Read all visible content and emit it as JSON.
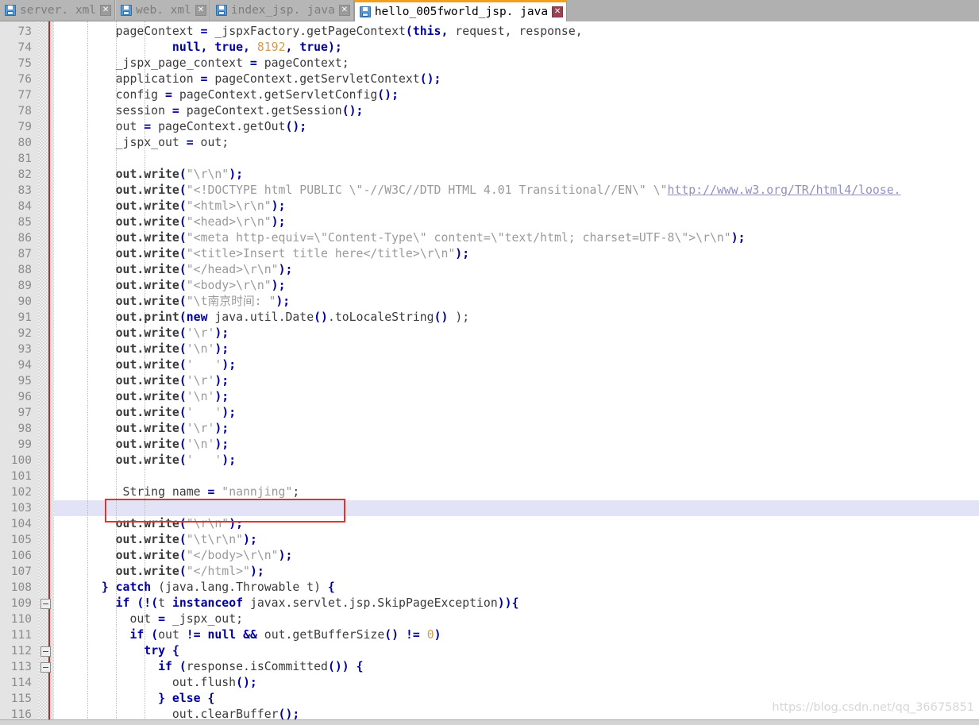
{
  "window": {
    "app": "Eclipse IDE Java Editor",
    "watermark": "https://blog.csdn.net/qq_36675851"
  },
  "tabs": [
    {
      "label": "server. xml",
      "icon": "save-floppy-icon",
      "active": false,
      "close": "✕"
    },
    {
      "label": "web. xml",
      "icon": "save-floppy-icon",
      "active": false,
      "close": "✕"
    },
    {
      "label": "index_jsp. java",
      "icon": "save-floppy-icon",
      "active": false,
      "close": "✕"
    },
    {
      "label": "hello_005fworld_jsp. java",
      "icon": "save-floppy-icon",
      "active": true,
      "close": "✕"
    }
  ],
  "editor": {
    "first_line": 73,
    "last_line": 116,
    "current_line": 103,
    "annotation": {
      "type": "red-rectangle",
      "target_line": 102,
      "target_text": "String name = \"nannjing\";"
    },
    "fold_marker_lines": [
      109,
      112,
      113
    ],
    "colors": {
      "keyword": "#00009e",
      "number": "#d69b4a",
      "string": "#9a9a9a",
      "plain": "#3b3b3b",
      "link": "#9090c0",
      "current_line_bg": "#e3e3f7",
      "gutter_bg": "#e4e4e4",
      "annotation_red": "#ea3223",
      "active_tab_accent": "#f4a017"
    },
    "lines": [
      {
        "n": 73,
        "tokens": [
          [
            "plain",
            "    pageContext "
          ],
          [
            "op",
            "= "
          ],
          [
            "plain",
            "_jspxFactory.getPageContext"
          ],
          [
            "op",
            "("
          ],
          [
            "kw",
            "this"
          ],
          [
            "op",
            ","
          ],
          [
            "plain",
            " request, response,"
          ]
        ]
      },
      {
        "n": 74,
        "tokens": [
          [
            "plain",
            "            "
          ],
          [
            "kw",
            "null"
          ],
          [
            "op",
            ", "
          ],
          [
            "kw",
            "true"
          ],
          [
            "op",
            ", "
          ],
          [
            "num",
            "8192"
          ],
          [
            "op",
            ", "
          ],
          [
            "kw",
            "true"
          ],
          [
            "op",
            ");"
          ]
        ]
      },
      {
        "n": 75,
        "tokens": [
          [
            "plain",
            "    _jspx_page_context "
          ],
          [
            "op",
            "= "
          ],
          [
            "plain",
            "pageContext;"
          ]
        ]
      },
      {
        "n": 76,
        "tokens": [
          [
            "plain",
            "    application "
          ],
          [
            "op",
            "= "
          ],
          [
            "plain",
            "pageContext.getServletContext"
          ],
          [
            "op",
            "();"
          ]
        ]
      },
      {
        "n": 77,
        "tokens": [
          [
            "plain",
            "    config "
          ],
          [
            "op",
            "= "
          ],
          [
            "plain",
            "pageContext.getServletConfig"
          ],
          [
            "op",
            "();"
          ]
        ]
      },
      {
        "n": 78,
        "tokens": [
          [
            "plain",
            "    session "
          ],
          [
            "op",
            "= "
          ],
          [
            "plain",
            "pageContext.getSession"
          ],
          [
            "op",
            "();"
          ]
        ]
      },
      {
        "n": 79,
        "tokens": [
          [
            "plain",
            "    out "
          ],
          [
            "op",
            "= "
          ],
          [
            "plain",
            "pageContext.getOut"
          ],
          [
            "op",
            "();"
          ]
        ]
      },
      {
        "n": 80,
        "tokens": [
          [
            "plain",
            "    _jspx_out "
          ],
          [
            "op",
            "= "
          ],
          [
            "plain",
            "out;"
          ]
        ]
      },
      {
        "n": 81,
        "tokens": []
      },
      {
        "n": 82,
        "tokens": [
          [
            "plain",
            "    "
          ],
          [
            "id",
            "out.write"
          ],
          [
            "op",
            "("
          ],
          [
            "str",
            "\"\\r\\n\""
          ],
          [
            "op",
            ");"
          ]
        ]
      },
      {
        "n": 83,
        "tokens": [
          [
            "plain",
            "    "
          ],
          [
            "id",
            "out.write"
          ],
          [
            "op",
            "("
          ],
          [
            "str",
            "\"<!DOCTYPE html PUBLIC \\\"-//W3C//DTD HTML 4.01 Transitional//EN\\\" \\\""
          ],
          [
            "link",
            "http://www.w3.org/TR/html4/loose."
          ]
        ]
      },
      {
        "n": 84,
        "tokens": [
          [
            "plain",
            "    "
          ],
          [
            "id",
            "out.write"
          ],
          [
            "op",
            "("
          ],
          [
            "str",
            "\"<html>\\r\\n\""
          ],
          [
            "op",
            ");"
          ]
        ]
      },
      {
        "n": 85,
        "tokens": [
          [
            "plain",
            "    "
          ],
          [
            "id",
            "out.write"
          ],
          [
            "op",
            "("
          ],
          [
            "str",
            "\"<head>\\r\\n\""
          ],
          [
            "op",
            ");"
          ]
        ]
      },
      {
        "n": 86,
        "tokens": [
          [
            "plain",
            "    "
          ],
          [
            "id",
            "out.write"
          ],
          [
            "op",
            "("
          ],
          [
            "str",
            "\"<meta http-equiv=\\\"Content-Type\\\" content=\\\"text/html; charset=UTF-8\\\">\\r\\n\""
          ],
          [
            "op",
            ");"
          ]
        ]
      },
      {
        "n": 87,
        "tokens": [
          [
            "plain",
            "    "
          ],
          [
            "id",
            "out.write"
          ],
          [
            "op",
            "("
          ],
          [
            "str",
            "\"<title>Insert title here</title>\\r\\n\""
          ],
          [
            "op",
            ");"
          ]
        ]
      },
      {
        "n": 88,
        "tokens": [
          [
            "plain",
            "    "
          ],
          [
            "id",
            "out.write"
          ],
          [
            "op",
            "("
          ],
          [
            "str",
            "\"</head>\\r\\n\""
          ],
          [
            "op",
            ");"
          ]
        ]
      },
      {
        "n": 89,
        "tokens": [
          [
            "plain",
            "    "
          ],
          [
            "id",
            "out.write"
          ],
          [
            "op",
            "("
          ],
          [
            "str",
            "\"<body>\\r\\n\""
          ],
          [
            "op",
            ");"
          ]
        ]
      },
      {
        "n": 90,
        "tokens": [
          [
            "plain",
            "    "
          ],
          [
            "id",
            "out.write"
          ],
          [
            "op",
            "("
          ],
          [
            "str",
            "\"\\t南京时间: \""
          ],
          [
            "op",
            ");"
          ]
        ]
      },
      {
        "n": 91,
        "tokens": [
          [
            "plain",
            "    "
          ],
          [
            "id",
            "out.print"
          ],
          [
            "op",
            "("
          ],
          [
            "kw",
            "new"
          ],
          [
            "plain",
            " java.util.Date"
          ],
          [
            "op",
            "()"
          ],
          [
            "plain",
            ".toLocaleString"
          ],
          [
            "op",
            "()"
          ],
          [
            "plain",
            " );"
          ]
        ]
      },
      {
        "n": 92,
        "tokens": [
          [
            "plain",
            "    "
          ],
          [
            "id",
            "out.write"
          ],
          [
            "op",
            "("
          ],
          [
            "str",
            "'\\r'"
          ],
          [
            "op",
            ");"
          ]
        ]
      },
      {
        "n": 93,
        "tokens": [
          [
            "plain",
            "    "
          ],
          [
            "id",
            "out.write"
          ],
          [
            "op",
            "("
          ],
          [
            "str",
            "'\\n'"
          ],
          [
            "op",
            ");"
          ]
        ]
      },
      {
        "n": 94,
        "tokens": [
          [
            "plain",
            "    "
          ],
          [
            "id",
            "out.write"
          ],
          [
            "op",
            "("
          ],
          [
            "str",
            "'   '"
          ],
          [
            "op",
            ");"
          ]
        ]
      },
      {
        "n": 95,
        "tokens": [
          [
            "plain",
            "    "
          ],
          [
            "id",
            "out.write"
          ],
          [
            "op",
            "("
          ],
          [
            "str",
            "'\\r'"
          ],
          [
            "op",
            ");"
          ]
        ]
      },
      {
        "n": 96,
        "tokens": [
          [
            "plain",
            "    "
          ],
          [
            "id",
            "out.write"
          ],
          [
            "op",
            "("
          ],
          [
            "str",
            "'\\n'"
          ],
          [
            "op",
            ");"
          ]
        ]
      },
      {
        "n": 97,
        "tokens": [
          [
            "plain",
            "    "
          ],
          [
            "id",
            "out.write"
          ],
          [
            "op",
            "("
          ],
          [
            "str",
            "'   '"
          ],
          [
            "op",
            ");"
          ]
        ]
      },
      {
        "n": 98,
        "tokens": [
          [
            "plain",
            "    "
          ],
          [
            "id",
            "out.write"
          ],
          [
            "op",
            "("
          ],
          [
            "str",
            "'\\r'"
          ],
          [
            "op",
            ");"
          ]
        ]
      },
      {
        "n": 99,
        "tokens": [
          [
            "plain",
            "    "
          ],
          [
            "id",
            "out.write"
          ],
          [
            "op",
            "("
          ],
          [
            "str",
            "'\\n'"
          ],
          [
            "op",
            ");"
          ]
        ]
      },
      {
        "n": 100,
        "tokens": [
          [
            "plain",
            "    "
          ],
          [
            "id",
            "out.write"
          ],
          [
            "op",
            "("
          ],
          [
            "str",
            "'   '"
          ],
          [
            "op",
            ");"
          ]
        ]
      },
      {
        "n": 101,
        "tokens": []
      },
      {
        "n": 102,
        "tokens": [
          [
            "plain",
            "     String name "
          ],
          [
            "op",
            "= "
          ],
          [
            "str",
            "\"nannjing\""
          ],
          [
            "plain",
            ";"
          ]
        ]
      },
      {
        "n": 103,
        "tokens": []
      },
      {
        "n": 104,
        "tokens": [
          [
            "plain",
            "    "
          ],
          [
            "id",
            "out.write"
          ],
          [
            "op",
            "("
          ],
          [
            "str",
            "\"\\r\\n\""
          ],
          [
            "op",
            ");"
          ]
        ]
      },
      {
        "n": 105,
        "tokens": [
          [
            "plain",
            "    "
          ],
          [
            "id",
            "out.write"
          ],
          [
            "op",
            "("
          ],
          [
            "str",
            "\"\\t\\r\\n\""
          ],
          [
            "op",
            ");"
          ]
        ]
      },
      {
        "n": 106,
        "tokens": [
          [
            "plain",
            "    "
          ],
          [
            "id",
            "out.write"
          ],
          [
            "op",
            "("
          ],
          [
            "str",
            "\"</body>\\r\\n\""
          ],
          [
            "op",
            ");"
          ]
        ]
      },
      {
        "n": 107,
        "tokens": [
          [
            "plain",
            "    "
          ],
          [
            "id",
            "out.write"
          ],
          [
            "op",
            "("
          ],
          [
            "str",
            "\"</html>\""
          ],
          [
            "op",
            ");"
          ]
        ]
      },
      {
        "n": 108,
        "tokens": [
          [
            "op",
            "  } "
          ],
          [
            "kw",
            "catch"
          ],
          [
            "plain",
            " (java.lang.Throwable t) "
          ],
          [
            "op",
            "{"
          ]
        ]
      },
      {
        "n": 109,
        "tokens": [
          [
            "plain",
            "    "
          ],
          [
            "kw",
            "if"
          ],
          [
            "plain",
            " "
          ],
          [
            "op",
            "(!("
          ],
          [
            "plain",
            "t "
          ],
          [
            "kw",
            "instanceof"
          ],
          [
            "plain",
            " javax.servlet.jsp.SkipPageException"
          ],
          [
            "op",
            ")){"
          ]
        ]
      },
      {
        "n": 110,
        "tokens": [
          [
            "plain",
            "      out "
          ],
          [
            "op",
            "= "
          ],
          [
            "plain",
            "_jspx_out;"
          ]
        ]
      },
      {
        "n": 111,
        "tokens": [
          [
            "plain",
            "      "
          ],
          [
            "kw",
            "if"
          ],
          [
            "plain",
            " "
          ],
          [
            "op",
            "("
          ],
          [
            "plain",
            "out "
          ],
          [
            "op",
            "!= "
          ],
          [
            "kw",
            "null"
          ],
          [
            "plain",
            " "
          ],
          [
            "op",
            "&& "
          ],
          [
            "plain",
            "out.getBufferSize"
          ],
          [
            "op",
            "() != "
          ],
          [
            "num",
            "0"
          ],
          [
            "op",
            ")"
          ]
        ]
      },
      {
        "n": 112,
        "tokens": [
          [
            "plain",
            "        "
          ],
          [
            "kw",
            "try"
          ],
          [
            "plain",
            " "
          ],
          [
            "op",
            "{"
          ]
        ]
      },
      {
        "n": 113,
        "tokens": [
          [
            "plain",
            "          "
          ],
          [
            "kw",
            "if"
          ],
          [
            "plain",
            " "
          ],
          [
            "op",
            "("
          ],
          [
            "plain",
            "response.isCommitted"
          ],
          [
            "op",
            "()) {"
          ]
        ]
      },
      {
        "n": 114,
        "tokens": [
          [
            "plain",
            "            out.flush"
          ],
          [
            "op",
            "();"
          ]
        ]
      },
      {
        "n": 115,
        "tokens": [
          [
            "op",
            "          } "
          ],
          [
            "kw",
            "else"
          ],
          [
            "plain",
            " "
          ],
          [
            "op",
            "{"
          ]
        ]
      },
      {
        "n": 116,
        "tokens": [
          [
            "plain",
            "            out.clearBuffer"
          ],
          [
            "op",
            "();"
          ]
        ]
      }
    ]
  }
}
